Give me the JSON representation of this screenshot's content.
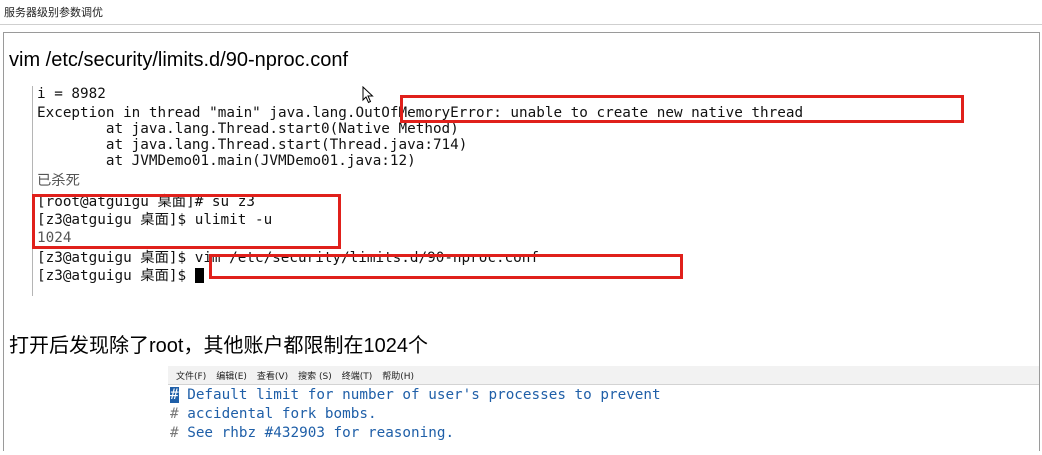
{
  "header": {
    "title": "服务器级别参数调优"
  },
  "command_title": "vim /etc/security/limits.d/90-nproc.conf",
  "terminal": {
    "lines": [
      "i = 8982",
      "Exception in thread \"main\" java.lang.OutOfMemoryError: unable to create new native thread",
      "        at java.lang.Thread.start0(Native Method)",
      "        at java.lang.Thread.start(Thread.java:714)",
      "        at JVMDemo01.main(JVMDemo01.java:12)",
      "已杀死",
      "[root@atguigu 桌面]# su z3",
      "[z3@atguigu 桌面]$ ulimit -u",
      "1024",
      "[z3@atguigu 桌面]$ vim /etc/security/limits.d/90-nproc.conf",
      "[z3@atguigu 桌面]$ "
    ]
  },
  "note": "打开后发现除了root，其他账户都限制在1024个",
  "editor": {
    "menu": [
      "文件(F)",
      "编辑(E)",
      "查看(V)",
      "搜索 (S)",
      "终端(T)",
      "帮助(H)"
    ],
    "lines": [
      {
        "hash": "#",
        "text": " Default limit for number of user's processes to prevent"
      },
      {
        "hash": "#",
        "text": " accidental fork bombs."
      },
      {
        "hash": "#",
        "text": " See rhbz #432903 for reasoning."
      }
    ]
  },
  "colors": {
    "highlight": "#e0201b",
    "editor_text": "#1f5fa8"
  },
  "icons": {
    "pointer": "mouse-pointer-icon"
  }
}
